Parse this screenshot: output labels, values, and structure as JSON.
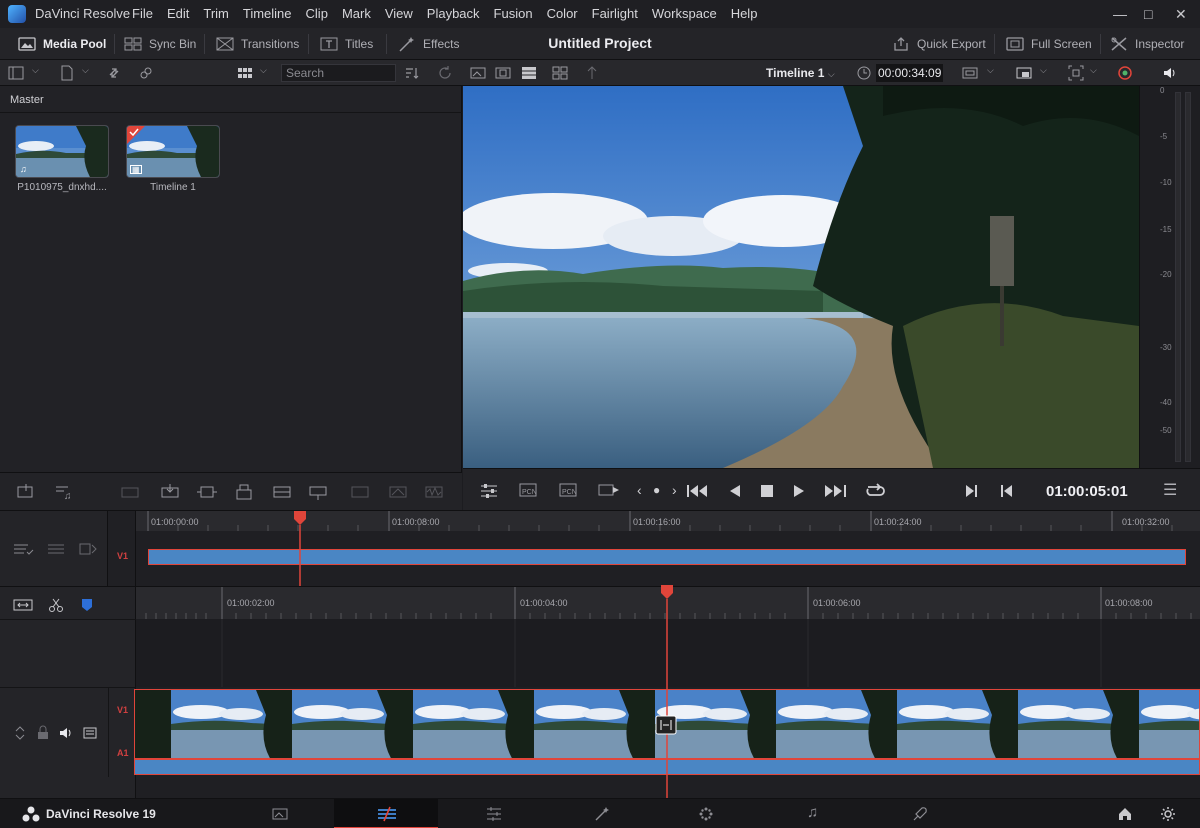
{
  "app": {
    "title": "DaVinci Resolve",
    "menus": [
      "File",
      "Edit",
      "Trim",
      "Timeline",
      "Clip",
      "Mark",
      "View",
      "Playback",
      "Fusion",
      "Color",
      "Fairlight",
      "Workspace",
      "Help"
    ]
  },
  "toolbar": {
    "media_pool": "Media Pool",
    "sync_bin": "Sync Bin",
    "transitions": "Transitions",
    "titles": "Titles",
    "effects": "Effects",
    "project_title": "Untitled Project",
    "quick_export": "Quick Export",
    "full_screen": "Full Screen",
    "inspector": "Inspector"
  },
  "subbar": {
    "search_placeholder": "Search",
    "timeline_name": "Timeline 1",
    "source_timecode": "00:00:34:09"
  },
  "media_pool": {
    "bin": "Master",
    "clips": [
      {
        "name": "P1010975_dnxhd....",
        "type": "audio-video"
      },
      {
        "name": "Timeline 1",
        "type": "timeline"
      }
    ]
  },
  "meter": {
    "labels": [
      "0",
      "-5",
      "-10",
      "-15",
      "-20",
      "-30",
      "-40",
      "-50"
    ]
  },
  "transport": {
    "timecode": "01:00:05:01"
  },
  "upper_timeline": {
    "ruler_labels": [
      "01:00:00:00",
      "01:00:08:00",
      "01:00:16:00",
      "01:00:24:00",
      "01:00:32:00"
    ],
    "track": "V1"
  },
  "lower_timeline": {
    "ruler_labels": [
      "01:00:02:00",
      "01:00:04:00",
      "01:00:06:00",
      "01:00:08:00"
    ],
    "video_track": "V1",
    "audio_track": "A1"
  },
  "bottom": {
    "brand": "DaVinci Resolve 19"
  },
  "colors": {
    "accent_red": "#e0453a",
    "clip_blue": "#4a86c4",
    "active_page": "#e0453a"
  }
}
